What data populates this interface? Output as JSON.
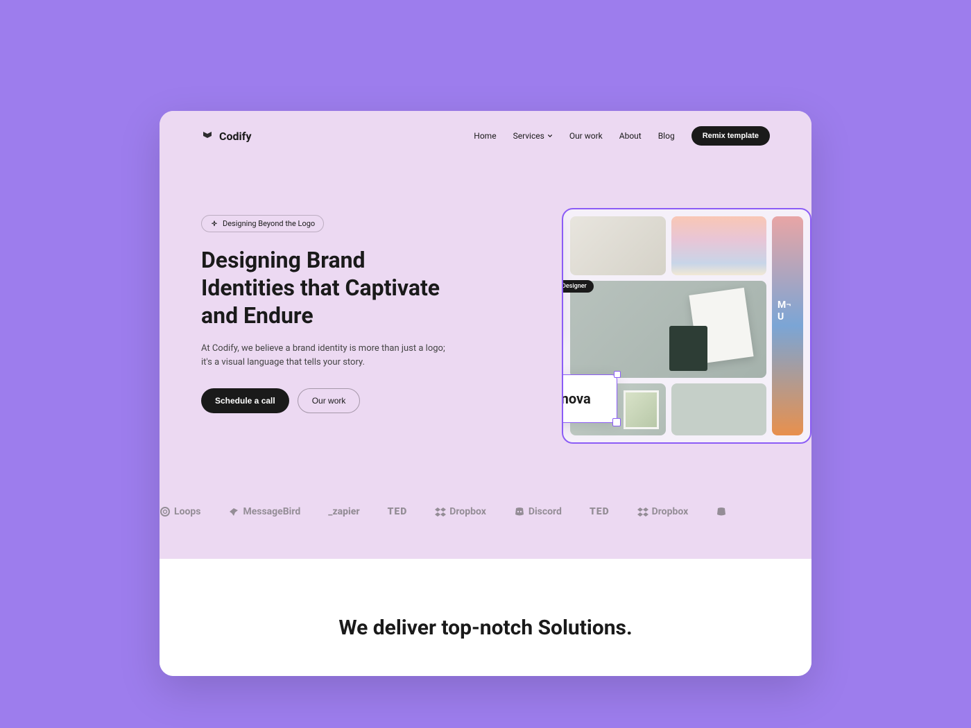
{
  "brand": {
    "name": "Codify"
  },
  "nav": {
    "items": [
      {
        "label": "Home",
        "hasDropdown": false
      },
      {
        "label": "Services",
        "hasDropdown": true
      },
      {
        "label": "Our work",
        "hasDropdown": false
      },
      {
        "label": "About",
        "hasDropdown": false
      },
      {
        "label": "Blog",
        "hasDropdown": false
      }
    ],
    "cta": "Remix template"
  },
  "hero": {
    "badge": "Designing Beyond the Logo",
    "title": "Designing Brand Identities that Captivate and Endure",
    "description": "At Codify, we believe a brand identity is more than just a logo; it's a visual language that tells your story.",
    "primary_cta": "Schedule a call",
    "secondary_cta": "Our work"
  },
  "moodboard": {
    "cursor_label": "Designer",
    "selected_card": "Finova",
    "swatches": [
      {
        "name": "light-gray",
        "color": "#f5f5f5"
      },
      {
        "name": "peach",
        "color": "#f9d5ca"
      },
      {
        "name": "lavender",
        "color": "#e0d5f5",
        "selected": true
      },
      {
        "name": "yellow",
        "color": "#efdaa8"
      },
      {
        "name": "sky",
        "color": "#b5e2ec"
      }
    ]
  },
  "client_logos": [
    "Loops",
    "MessageBird",
    "_zapier",
    "TED",
    "Dropbox",
    "Discord",
    "TED",
    "Dropbox"
  ],
  "solutions": {
    "title": "We deliver top-notch Solutions."
  }
}
